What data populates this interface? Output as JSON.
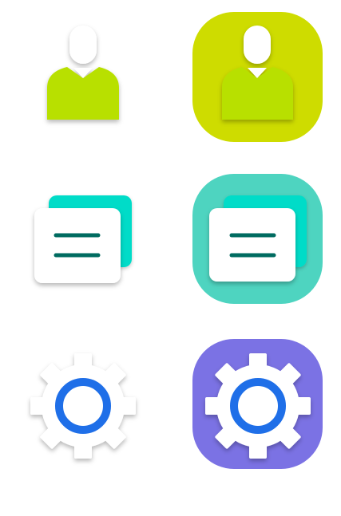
{
  "icon_grid": {
    "rows": [
      {
        "name": "contacts",
        "plain_icon": "person-icon",
        "tile_icon": "person-icon",
        "tile_color": "#cedc00",
        "accent_color": "#b5e000"
      },
      {
        "name": "messages",
        "plain_icon": "message-cards-icon",
        "tile_icon": "message-cards-icon",
        "tile_color": "#4ed4c0",
        "accent_color": "#00dcc8",
        "line_color": "#006b60"
      },
      {
        "name": "settings",
        "plain_icon": "gear-icon",
        "tile_icon": "gear-icon",
        "tile_color": "#7b72e4",
        "accent_color": "#1f6fe8"
      }
    ]
  }
}
